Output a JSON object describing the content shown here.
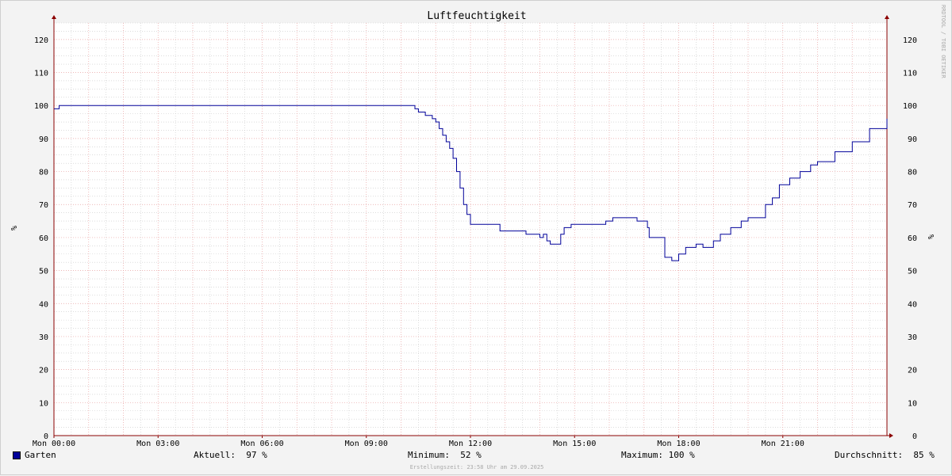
{
  "chart_data": {
    "type": "line",
    "title": "Luftfeuchtigkeit",
    "ylabel": "%",
    "ylim": [
      0,
      125
    ],
    "y_ticks": [
      0,
      10,
      20,
      30,
      40,
      50,
      60,
      70,
      80,
      90,
      100,
      110,
      120
    ],
    "xlim": [
      0,
      24
    ],
    "x_ticks": [
      {
        "hour": 0,
        "label": "Mon 00:00"
      },
      {
        "hour": 3,
        "label": "Mon 03:00"
      },
      {
        "hour": 6,
        "label": "Mon 06:00"
      },
      {
        "hour": 9,
        "label": "Mon 09:00"
      },
      {
        "hour": 12,
        "label": "Mon 12:00"
      },
      {
        "hour": 15,
        "label": "Mon 15:00"
      },
      {
        "hour": 18,
        "label": "Mon 18:00"
      },
      {
        "hour": 21,
        "label": "Mon 21:00"
      }
    ],
    "grid": true,
    "colors": {
      "line": "#000099",
      "grid_major": "#e8a0a0",
      "grid_minor": "#c8c8c8",
      "axis": "#8b0000"
    },
    "series": [
      {
        "name": "Garten",
        "x": [
          0,
          0.1,
          0.15,
          10.3,
          10.4,
          10.5,
          10.7,
          10.9,
          11.0,
          11.1,
          11.2,
          11.3,
          11.4,
          11.5,
          11.6,
          11.7,
          11.8,
          11.9,
          12.0,
          12.1,
          12.2,
          12.3,
          12.4,
          12.5,
          12.85,
          12.95,
          13.6,
          13.9,
          14.0,
          14.1,
          14.2,
          14.3,
          14.5,
          14.6,
          14.7,
          14.9,
          15.5,
          15.9,
          16.1,
          16.8,
          17.1,
          17.15,
          17.4,
          17.6,
          17.8,
          18.0,
          18.2,
          18.5,
          18.7,
          19.0,
          19.2,
          19.5,
          19.8,
          20.0,
          20.5,
          20.7,
          20.9,
          21.2,
          21.5,
          21.8,
          22.0,
          22.5,
          23.0,
          23.5,
          24.0
        ],
        "y": [
          99,
          99,
          100,
          100,
          99,
          98,
          97,
          96,
          95,
          93,
          91,
          89,
          87,
          84,
          80,
          75,
          70,
          67,
          64,
          64,
          64,
          64,
          64,
          64,
          62,
          62,
          61,
          61,
          60,
          61,
          59,
          58,
          58,
          61,
          63,
          64,
          64,
          65,
          66,
          65,
          63,
          60,
          60,
          54,
          53,
          55,
          57,
          58,
          57,
          59,
          61,
          63,
          65,
          66,
          70,
          72,
          76,
          78,
          80,
          82,
          83,
          86,
          89,
          93,
          96
        ]
      }
    ]
  },
  "legend": {
    "series_label": "Garten",
    "current": "Aktuell:  97 %",
    "minimum": "Minimum:  52 %",
    "maximum": "Maximum: 100 %",
    "average": "Durchschnitt:  85 %"
  },
  "watermark": "RRDTOOL / TOBI OETIKER",
  "footer": "Erstellungszeit: 23:58 Uhr am 29.09.2025"
}
